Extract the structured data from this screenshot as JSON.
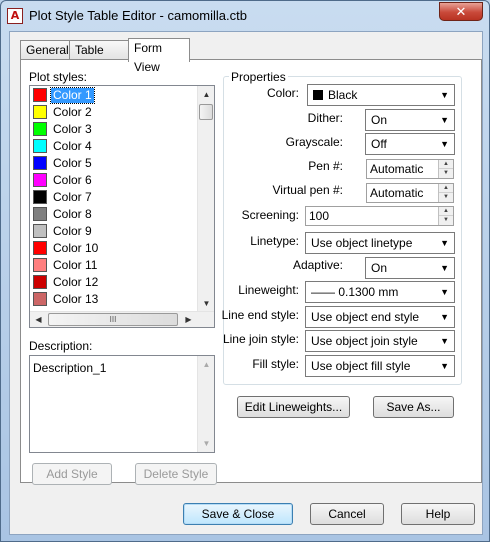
{
  "window": {
    "title": "Plot Style Table Editor - camomilla.ctb",
    "close_glyph": "✕",
    "app_icon_glyph": "A"
  },
  "tabs": [
    {
      "label": "General"
    },
    {
      "label": "Table View"
    },
    {
      "label": "Form View",
      "active": true
    }
  ],
  "plot_styles": {
    "label": "Plot styles:",
    "selected": "Color 1",
    "items": [
      {
        "label": "Color 1",
        "color": "#ff0000"
      },
      {
        "label": "Color 2",
        "color": "#ffff00"
      },
      {
        "label": "Color 3",
        "color": "#00ff00"
      },
      {
        "label": "Color 4",
        "color": "#00ffff"
      },
      {
        "label": "Color 5",
        "color": "#0000ff"
      },
      {
        "label": "Color 6",
        "color": "#ff00ff"
      },
      {
        "label": "Color 7",
        "color": "#000000"
      },
      {
        "label": "Color 8",
        "color": "#808080"
      },
      {
        "label": "Color 9",
        "color": "#c0c0c0"
      },
      {
        "label": "Color 10",
        "color": "#ff0000"
      },
      {
        "label": "Color 11",
        "color": "#ff7f7f"
      },
      {
        "label": "Color 12",
        "color": "#cc0000"
      },
      {
        "label": "Color 13",
        "color": "#cc6666"
      }
    ],
    "scroll_glyphs": {
      "up": "▲",
      "down": "▼",
      "left": "◀",
      "right": "▶",
      "grip": "III"
    }
  },
  "description": {
    "label": "Description:",
    "value": "Description_1"
  },
  "list_buttons": {
    "add_style": "Add Style",
    "delete_style": "Delete Style"
  },
  "properties": {
    "group_title": "Properties",
    "color": {
      "label": "Color:",
      "value": "Black",
      "swatch": "#000000"
    },
    "dither": {
      "label": "Dither:",
      "value": "On"
    },
    "grayscale": {
      "label": "Grayscale:",
      "value": "Off"
    },
    "pen": {
      "label": "Pen #:",
      "value": "Automatic"
    },
    "virtual_pen": {
      "label": "Virtual pen #:",
      "value": "Automatic"
    },
    "screening": {
      "label": "Screening:",
      "value": "100"
    },
    "linetype": {
      "label": "Linetype:",
      "value": "Use object linetype"
    },
    "adaptive": {
      "label": "Adaptive:",
      "value": "On"
    },
    "lineweight": {
      "label": "Lineweight:",
      "value": "—— 0.1300 mm"
    },
    "line_end": {
      "label": "Line end style:",
      "value": "Use object end style"
    },
    "line_join": {
      "label": "Line join style:",
      "value": "Use object join style"
    },
    "fill": {
      "label": "Fill style:",
      "value": "Use object fill style"
    }
  },
  "action_buttons": {
    "edit_lineweights": "Edit Lineweights...",
    "save_as": "Save As..."
  },
  "footer_buttons": {
    "save_close": "Save & Close",
    "cancel": "Cancel",
    "help": "Help"
  },
  "glyphs": {
    "dropdown": "▼",
    "spin_up": "▲",
    "spin_down": "▼"
  }
}
